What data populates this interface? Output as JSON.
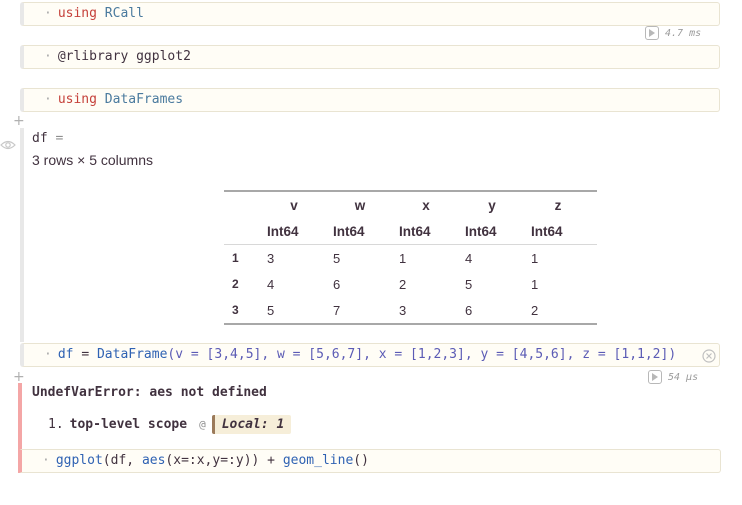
{
  "cells": {
    "c1": {
      "dot": "·",
      "kw": "using",
      "mod": "RCall"
    },
    "c1_runtime": "4.7 ms",
    "c2": {
      "dot": "·",
      "macro": "@rlibrary",
      "arg": "ggplot2"
    },
    "c3": {
      "dot": "·",
      "kw": "using",
      "mod": "DataFrames"
    },
    "df_cell": {
      "var": "df",
      "eq": "=",
      "summary": "3 rows × 5 columns",
      "columns": [
        "v",
        "w",
        "x",
        "y",
        "z"
      ],
      "types": [
        "Int64",
        "Int64",
        "Int64",
        "Int64",
        "Int64"
      ],
      "rows": [
        {
          "idx": "1",
          "vals": [
            "3",
            "5",
            "1",
            "4",
            "1"
          ]
        },
        {
          "idx": "2",
          "vals": [
            "4",
            "6",
            "2",
            "5",
            "1"
          ]
        },
        {
          "idx": "3",
          "vals": [
            "5",
            "7",
            "3",
            "6",
            "2"
          ]
        }
      ],
      "code": {
        "dot": "·",
        "lhs": "df",
        "eq": "=",
        "fn": "DataFrame",
        "args": "(v = [3,4,5], w = [5,6,7], x = [1,2,3], y = [4,5,6], z = [1,1,2])"
      },
      "runtime": "54 μs"
    },
    "err_cell": {
      "error": "UndefVarError: aes not defined",
      "trace_num": "1.",
      "trace_scope": "top-level scope",
      "trace_at": "@",
      "trace_loc": "Local: 1",
      "code": {
        "dot": "·",
        "fn1": "ggplot",
        "p1": "(df,",
        "fn2": "aes",
        "p2": "(x=:x,y=:y)) +",
        "fn3": "geom_line",
        "p3": "()"
      }
    }
  },
  "colors": {
    "error_bar": "#f4a6a6",
    "type_text": "#41323f",
    "keyword": "#c5403a"
  }
}
